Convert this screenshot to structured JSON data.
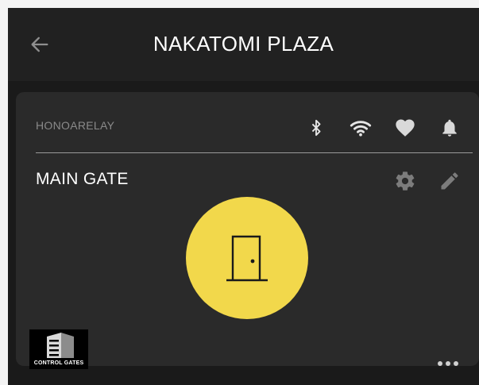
{
  "header": {
    "title": "NAKATOMI PLAZA",
    "back_icon": "arrow-left-icon"
  },
  "card": {
    "relay_name": "HONOARELAY",
    "status_icons": [
      "bluetooth-icon",
      "wifi-icon",
      "heart-icon",
      "bell-icon"
    ],
    "gate_name": "MAIN GATE",
    "gate_actions": [
      "gear-icon",
      "pencil-icon"
    ],
    "gate_button_icon": "door-icon",
    "logo_text": "CONTROL GATES",
    "more_icon": "ellipsis-icon"
  },
  "colors": {
    "background": "#1a1a1a",
    "header": "#212121",
    "card": "#2a2a2a",
    "accent": "#f2d84b",
    "icon": "#d9d9d9"
  }
}
